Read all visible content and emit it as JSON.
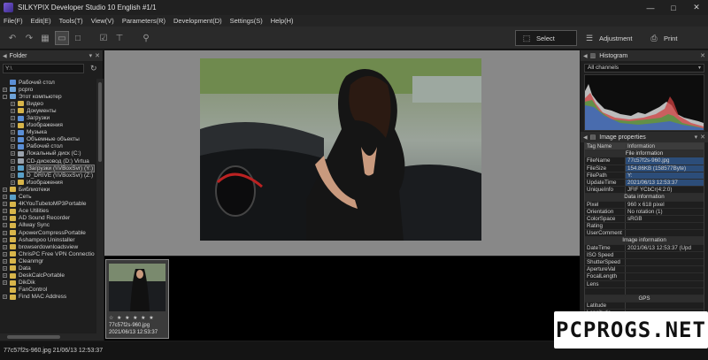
{
  "window": {
    "title": "SILKYPIX Developer Studio 10 English  #1/1",
    "controls": [
      "—",
      "□",
      "✕"
    ]
  },
  "menu": [
    "File(F)",
    "Edit(E)",
    "Tools(T)",
    "View(V)",
    "Parameters(R)",
    "Development(D)",
    "Settings(S)",
    "Help(H)"
  ],
  "toolbar": {
    "icons": [
      "undo-icon",
      "redo-icon",
      "grid-view-icon",
      "compare-view-icon",
      "single-view-icon",
      "preview-icon",
      "checkbox-icon",
      "straighten-icon",
      "inspect-icon"
    ],
    "modes": {
      "select": "Select",
      "adjustment": "Adjustment",
      "print": "Print"
    }
  },
  "folder_panel": {
    "title": "Folder",
    "path": "Y:\\",
    "tree": [
      {
        "label": "Рабочий стол",
        "level": 0,
        "icon": "blue",
        "exp": ""
      },
      {
        "label": "pcpro",
        "level": 0,
        "icon": "pc",
        "exp": "+"
      },
      {
        "label": "Этот компьютер",
        "level": 0,
        "icon": "pc",
        "exp": "-"
      },
      {
        "label": "Видео",
        "level": 1,
        "icon": "folder",
        "exp": "+"
      },
      {
        "label": "Документы",
        "level": 1,
        "icon": "folder",
        "exp": "+"
      },
      {
        "label": "Загрузки",
        "level": 1,
        "icon": "blue",
        "exp": "+"
      },
      {
        "label": "Изображения",
        "level": 1,
        "icon": "folder",
        "exp": "+"
      },
      {
        "label": "Музыка",
        "level": 1,
        "icon": "blue",
        "exp": "+"
      },
      {
        "label": "Объемные объекты",
        "level": 1,
        "icon": "blue",
        "exp": "+"
      },
      {
        "label": "Рабочий стол",
        "level": 1,
        "icon": "blue",
        "exp": "+"
      },
      {
        "label": "Локальный диск (C:)",
        "level": 1,
        "icon": "drive",
        "exp": "+"
      },
      {
        "label": "CD-дисковод (D:) Virtua",
        "level": 1,
        "icon": "drive",
        "exp": "+"
      },
      {
        "label": "Загрузки (\\\\VBoxSvr) (Y:)",
        "level": 1,
        "icon": "net",
        "exp": "+",
        "selected": true
      },
      {
        "label": "D_DRIVE (\\\\VBoxSvr) (Z:)",
        "level": 1,
        "icon": "net",
        "exp": "+"
      },
      {
        "label": "Изображения",
        "level": 1,
        "icon": "folder",
        "exp": "+"
      },
      {
        "label": "Библиотеки",
        "level": 0,
        "icon": "folder",
        "exp": "+"
      },
      {
        "label": "Сеть",
        "level": 0,
        "icon": "net",
        "exp": "+"
      },
      {
        "label": "4KYouTubetoMP3Portable",
        "level": 0,
        "icon": "folder",
        "exp": "+"
      },
      {
        "label": "Ace Utilities",
        "level": 0,
        "icon": "folder",
        "exp": "+"
      },
      {
        "label": "AD Sound Recorder",
        "level": 0,
        "icon": "folder",
        "exp": "+"
      },
      {
        "label": "Allway Sync",
        "level": 0,
        "icon": "folder",
        "exp": "+"
      },
      {
        "label": "ApowerCompressPortable",
        "level": 0,
        "icon": "folder",
        "exp": "+"
      },
      {
        "label": "Ashampoo Uninstaller",
        "level": 0,
        "icon": "folder",
        "exp": "+"
      },
      {
        "label": "browserdownloadsview",
        "level": 0,
        "icon": "folder",
        "exp": "+"
      },
      {
        "label": "ChrisPC Free VPN Connectio",
        "level": 0,
        "icon": "folder",
        "exp": "+"
      },
      {
        "label": "Cleanmgr",
        "level": 0,
        "icon": "folder",
        "exp": "+"
      },
      {
        "label": "Data",
        "level": 0,
        "icon": "folder",
        "exp": "+"
      },
      {
        "label": "DeskCalcPortable",
        "level": 0,
        "icon": "folder",
        "exp": "+"
      },
      {
        "label": "DikDik",
        "level": 0,
        "icon": "folder",
        "exp": "+"
      },
      {
        "label": "FanControl",
        "level": 0,
        "icon": "folder",
        "exp": ""
      },
      {
        "label": "Find MAC Address",
        "level": 0,
        "icon": "folder",
        "exp": "+"
      }
    ]
  },
  "thumbnail": {
    "stars": "☆ ★ ★ ★ ★ ★",
    "filename": "77c57f2s-960.jpg",
    "date": "2021/06/13 12:53:37"
  },
  "histogram": {
    "title": "Histogram",
    "channel": "All channels"
  },
  "image_properties": {
    "title": "Image properties",
    "columns": [
      "Tag Name",
      "Information"
    ],
    "rows": [
      {
        "type": "section",
        "label": "File information"
      },
      {
        "k": "FileName",
        "v": "77c57f2s-960.jpg",
        "selected": true
      },
      {
        "k": "FileSize",
        "v": "154.86KB (158577Byte)",
        "selected": true
      },
      {
        "k": "FilePath",
        "v": "Y:",
        "selected": true
      },
      {
        "k": "UpdateTime",
        "v": "2021/06/13 12:53:37",
        "selected": true
      },
      {
        "k": "UniqueInfo",
        "v": "JFIF YCbCr(4:2:0)"
      },
      {
        "type": "section",
        "label": "Data information"
      },
      {
        "k": "Pixel",
        "v": "960 x 618 pixel"
      },
      {
        "k": "Orientation",
        "v": "No rotation (1)"
      },
      {
        "k": "ColorSpace",
        "v": "sRGB"
      },
      {
        "k": "Rating",
        "v": ""
      },
      {
        "k": "UserComment",
        "v": ""
      },
      {
        "type": "section",
        "label": "Image information"
      },
      {
        "k": "DateTime",
        "v": "2021/06/13 12:53:37 (Upd"
      },
      {
        "k": "ISO Speed",
        "v": ""
      },
      {
        "k": "ShutterSpeed",
        "v": ""
      },
      {
        "k": "ApertureVal",
        "v": ""
      },
      {
        "k": "FocalLength",
        "v": ""
      },
      {
        "k": "Lens",
        "v": ""
      },
      {
        "k": "",
        "v": ""
      },
      {
        "type": "section",
        "label": "GPS"
      },
      {
        "k": "Latitude",
        "v": ""
      },
      {
        "k": "Longitude",
        "v": ""
      }
    ]
  },
  "status": {
    "text": "77c57f2s-960.jpg 21/06/13 12:53:37"
  },
  "watermark": {
    "text": "PCPROGS.NET"
  },
  "colors": {
    "accent": "#2c4d79",
    "viewer_bg": "#888888",
    "folder": "#d8b54a"
  }
}
